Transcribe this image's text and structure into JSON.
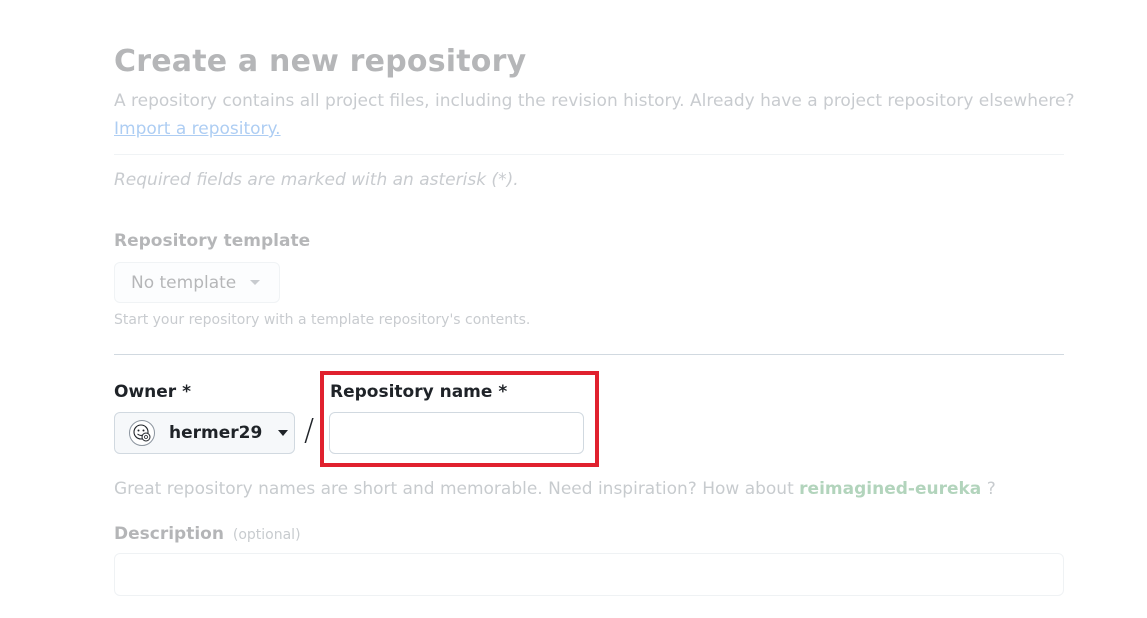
{
  "page": {
    "title": "Create a new repository",
    "lead": "A repository contains all project files, including the revision history. Already have a project repository elsewhere?",
    "import_link": "Import a repository.",
    "required_note": "Required fields are marked with an asterisk (*)."
  },
  "template": {
    "label": "Repository template",
    "selected": "No template",
    "hint": "Start your repository with a template repository's contents."
  },
  "owner": {
    "label": "Owner *",
    "name": "hermer29"
  },
  "separator": "/",
  "repo_name": {
    "label": "Repository name *",
    "value": "",
    "hint_prefix": "Great repository names are short and memorable. Need inspiration? How about",
    "suggestion": "reimagined-eureka",
    "hint_suffix": "?"
  },
  "description": {
    "label": "Description",
    "optional": "(optional)",
    "value": ""
  },
  "colors": {
    "highlight": "#e0212e",
    "link": "#0969da",
    "suggestion": "#1a7f37"
  },
  "icons": {
    "owner_avatar": "avatar-icon",
    "dropdown": "caret-down-icon"
  }
}
